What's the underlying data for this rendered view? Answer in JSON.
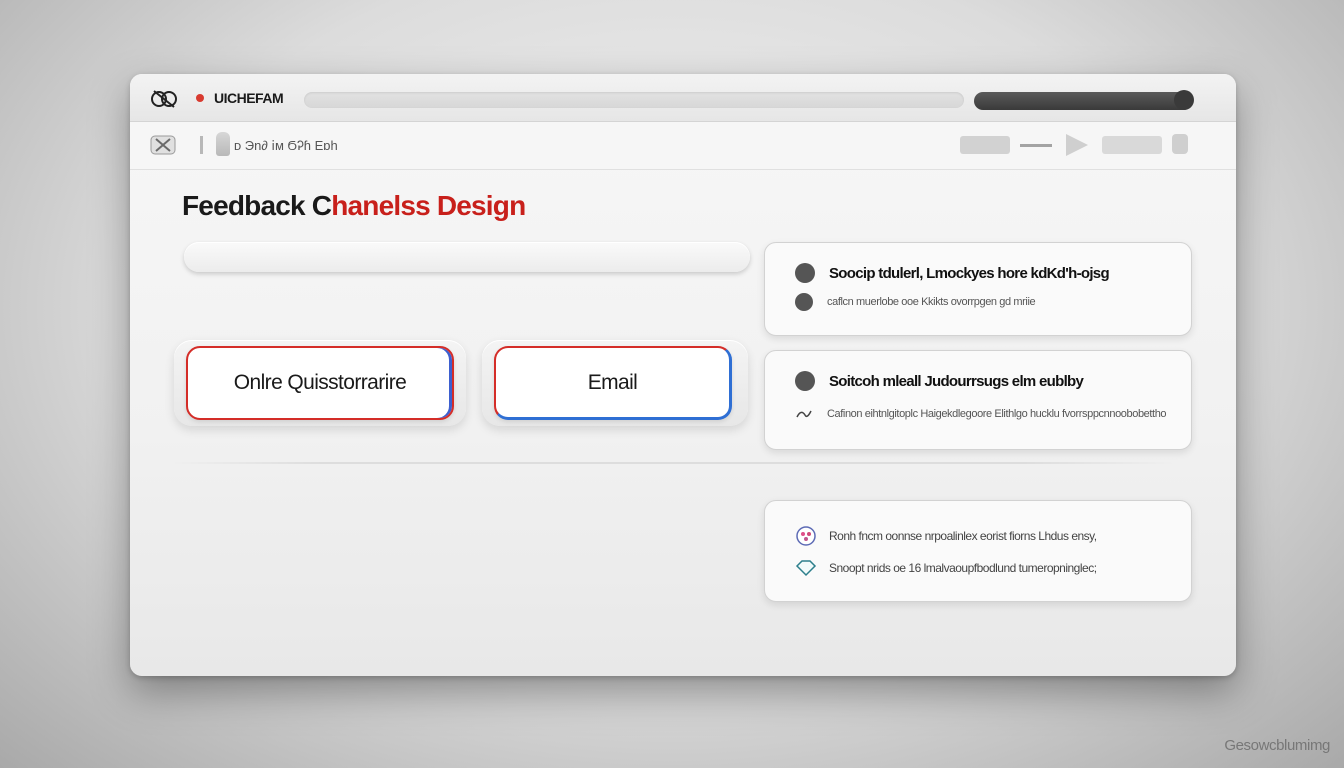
{
  "titlebar": {
    "app_name": "UICHEFAM"
  },
  "toolbar": {
    "breadcrumb": "ᴅ Эn∂ 𝗂м ϬᎮɦ Eɒh"
  },
  "page": {
    "title_black": "Feedback C",
    "title_red": "hanelss Design"
  },
  "search": {
    "placeholder": ""
  },
  "channels": {
    "questionnaire_label": "Onlre Quisstorrarire",
    "email_label": "Email"
  },
  "cards": {
    "card1": {
      "heading": "Soocip tdulerl, Lmockyes hore kdKd'h-ojsg",
      "subtext": "caflcn muerlobe ooe Kkikts ovorrpgen ɡd mriie"
    },
    "card2": {
      "heading": "Soitcoh mleall Judourrsugs elm eublby",
      "subtext": "Cafinon eihtnlgitoplc Haigekdlegoore Elithlgo hucklu fvorrsppcnnoobobettho"
    },
    "card3": {
      "item1": "Ronh fncm oonnse nrpoalinlex eorist fiorns Lhdus ensy,",
      "item2": "Snoopt nrids oe 16 lmalvaoupfbodlund tumeropninglec;"
    }
  },
  "watermark": "Gesowcblumimg",
  "colors": {
    "accent_red": "#c8201b",
    "accent_blue": "#2f6fd4"
  },
  "icons": [
    "app-logo-icon",
    "record-dot-icon",
    "toolbar-back-icon",
    "play-icon",
    "bullet-dot-icon",
    "chevron-icon",
    "palette-icon",
    "diamond-icon"
  ]
}
